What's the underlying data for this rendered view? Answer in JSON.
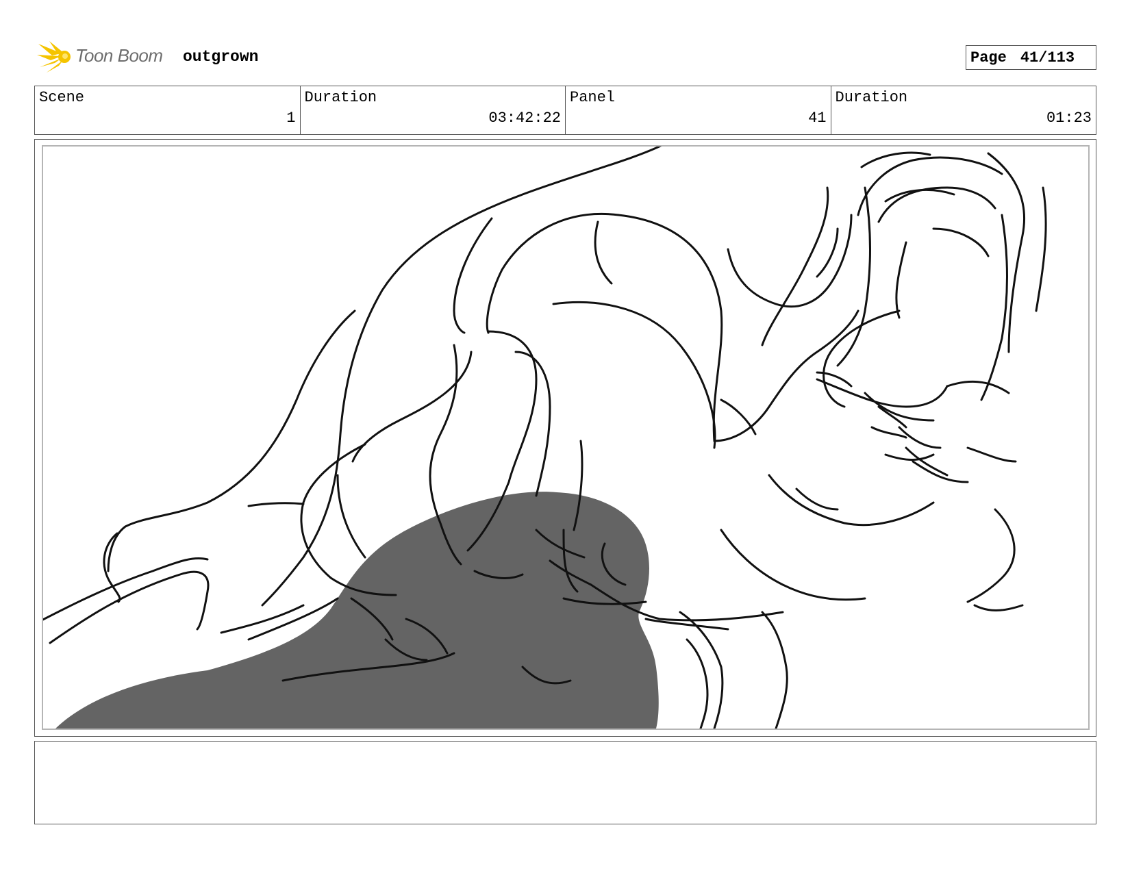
{
  "header": {
    "logo_text": "Toon Boom",
    "project_title": "outgrown",
    "page_label": "Page",
    "page_value": "41/113"
  },
  "info": [
    {
      "label": "Scene",
      "value": "1"
    },
    {
      "label": "Duration",
      "value": "03:42:22"
    },
    {
      "label": "Panel",
      "value": "41"
    },
    {
      "label": "Duration",
      "value": "01:23"
    }
  ],
  "notes": {
    "text": ""
  },
  "colors": {
    "logo_flash": "#f5c400",
    "logo_text": "#6d6d6d",
    "frame_border": "#555555",
    "safe_area_border": "#b5b5b5",
    "shadow_fill": "#646464",
    "sketch_stroke": "#111111"
  }
}
